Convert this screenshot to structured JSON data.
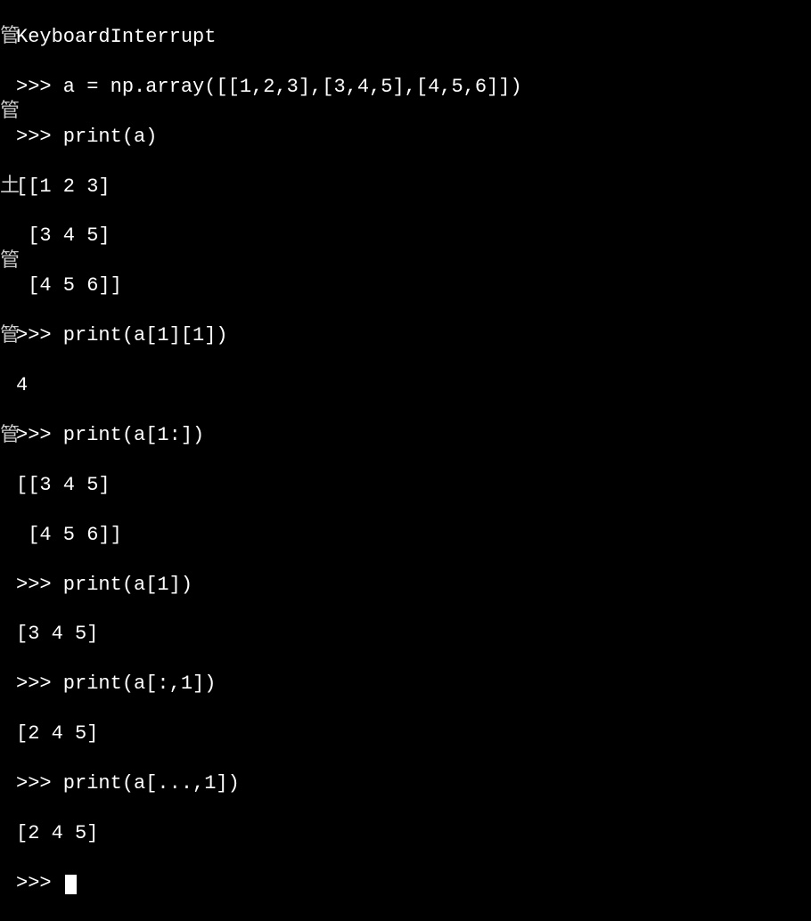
{
  "edge_chars": {
    "e0": "",
    "e1": "管",
    "e2": "",
    "e3": "",
    "e4": "管",
    "e5": "",
    "e6": "",
    "e7": "土",
    "e8": "",
    "e9": "",
    "e10": "管",
    "e11": "",
    "e12": "",
    "e13": "管",
    "e14": "",
    "e15": "",
    "e16": "",
    "e17": "管"
  },
  "lines": {
    "l0": "KeyboardInterrupt",
    "l1": ">>> a = np.array([[1,2,3],[3,4,5],[4,5,6]])",
    "l2": ">>> print(a)",
    "l3": "[[1 2 3]",
    "l4": " [3 4 5]",
    "l5": " [4 5 6]]",
    "l6": ">>> print(a[1][1])",
    "l7": "4",
    "l8": ">>> print(a[1:])",
    "l9": "[[3 4 5]",
    "l10": " [4 5 6]]",
    "l11": ">>> print(a[1])",
    "l12": "[3 4 5]",
    "l13": ">>> print(a[:,1])",
    "l14": "[2 4 5]",
    "l15": ">>> print(a[...,1])",
    "l16": "[2 4 5]",
    "l17": ">>> "
  },
  "cursor": "█"
}
